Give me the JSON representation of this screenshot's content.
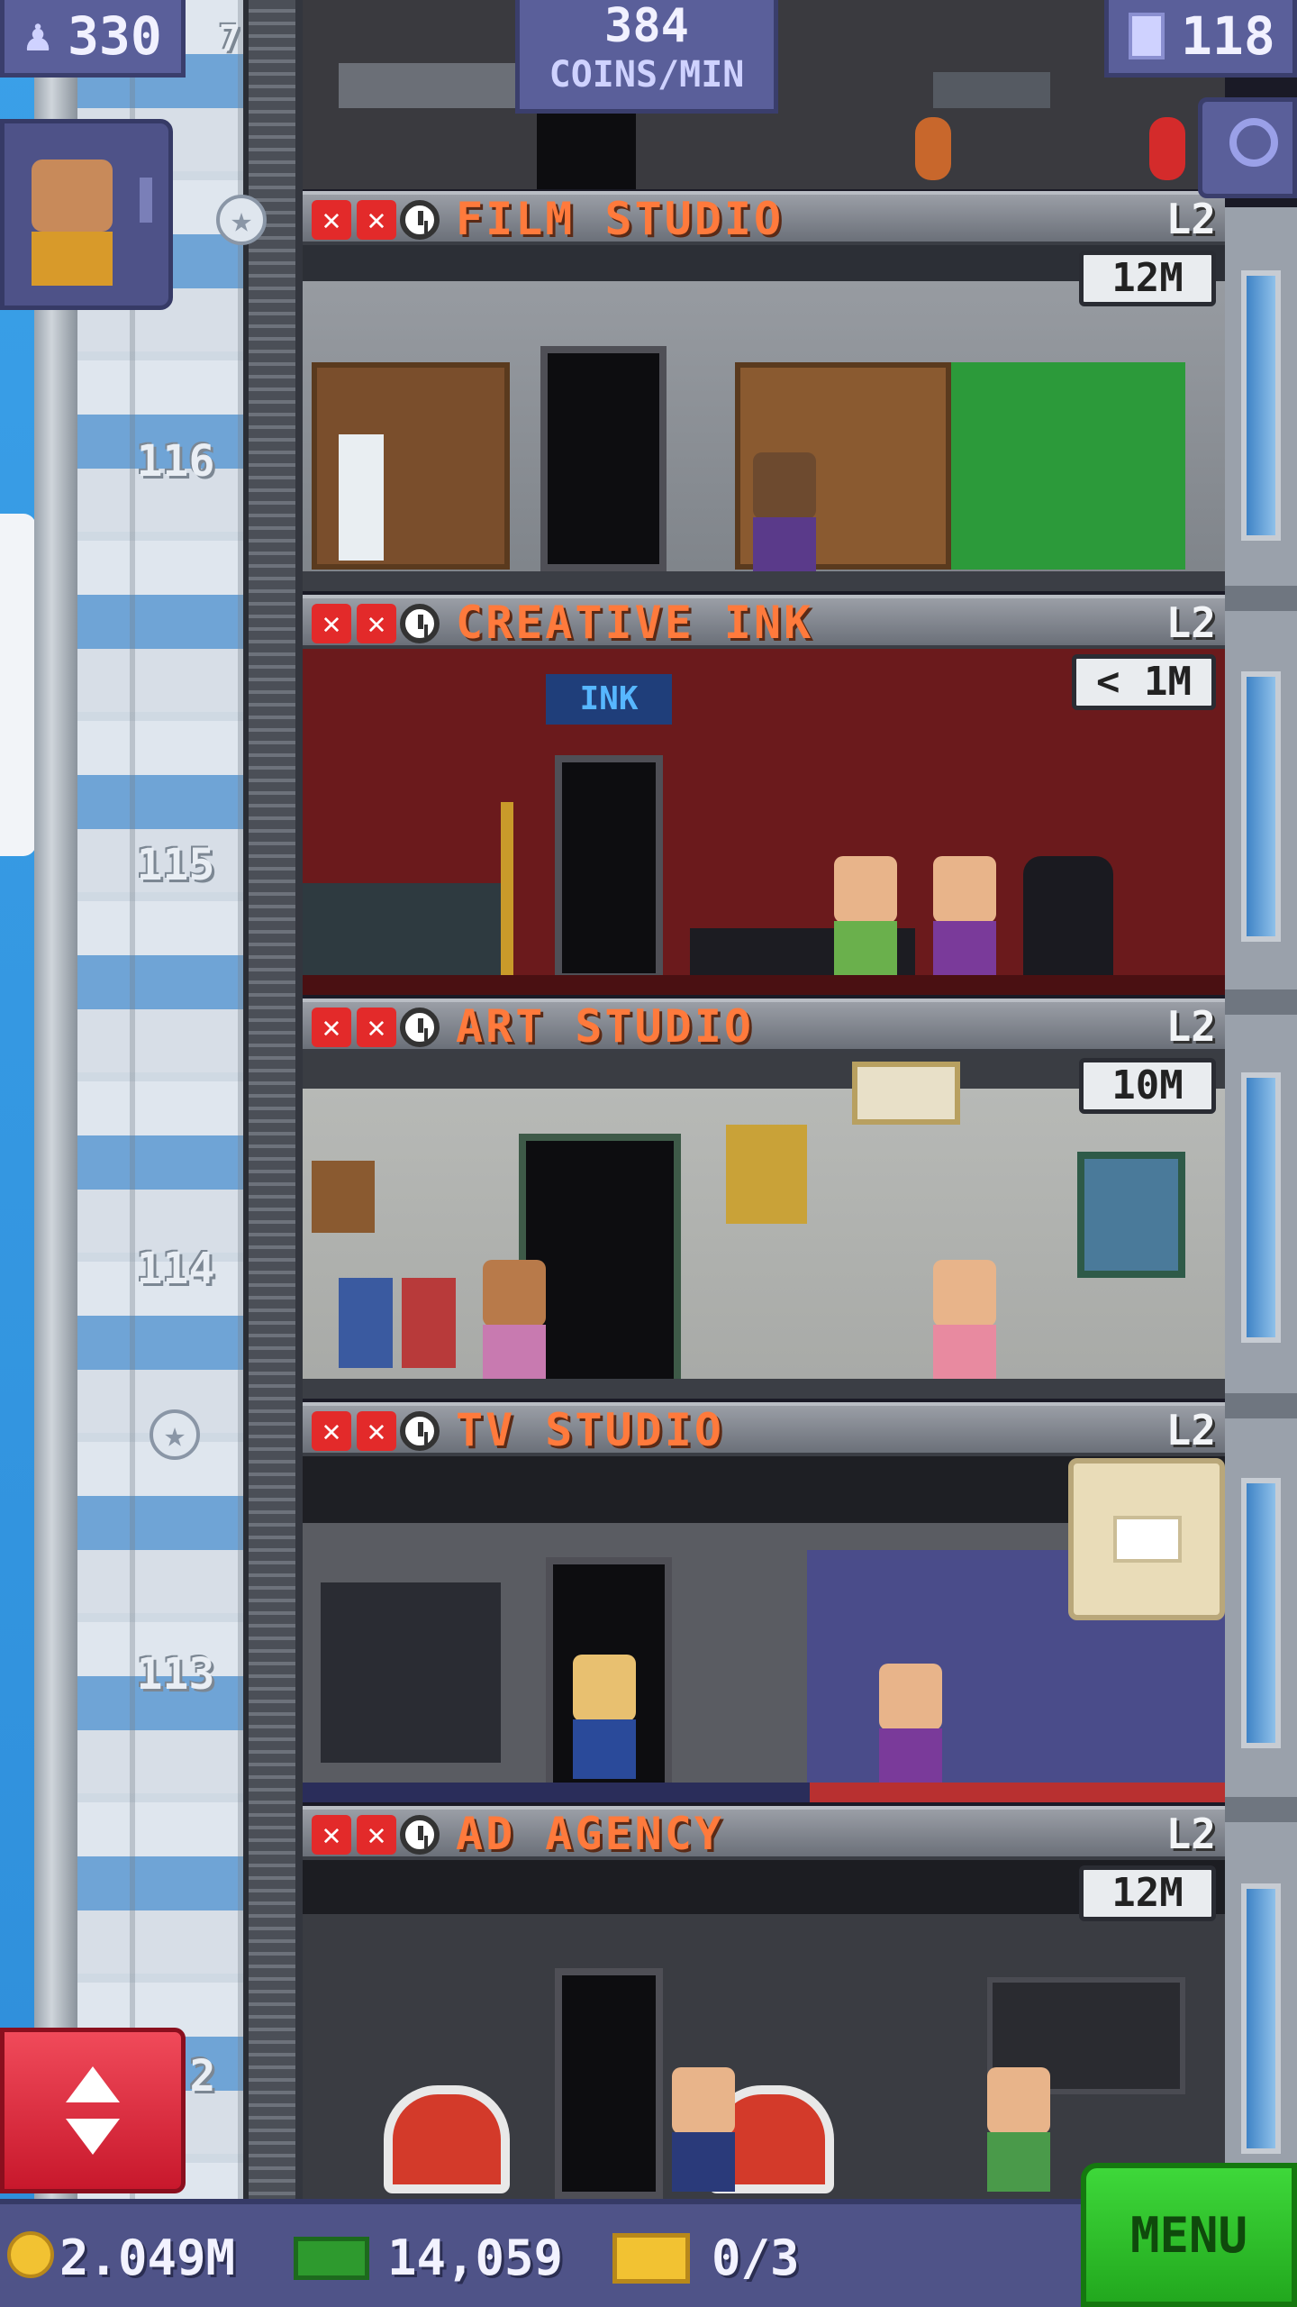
{
  "hud": {
    "population": "330",
    "coins_rate_value": "384",
    "coins_rate_unit": "COINS/MIN",
    "floors": "118"
  },
  "floor_numbers": [
    "116",
    "115",
    "114",
    "113",
    "2",
    "7"
  ],
  "rooms": [
    {
      "name": "FILM STUDIO",
      "level": "L2",
      "timer": "12M"
    },
    {
      "name": "CREATIVE INK",
      "level": "L2",
      "timer": "< 1M",
      "sign": "INK"
    },
    {
      "name": "ART STUDIO",
      "level": "L2",
      "timer": "10M"
    },
    {
      "name": "TV STUDIO",
      "level": "L2",
      "timer": ""
    },
    {
      "name": "AD AGENCY",
      "level": "L2",
      "timer": "12M"
    }
  ],
  "bottom": {
    "coins": "2.049M",
    "bux": "14,059",
    "tickets": "0/3",
    "menu": "MENU"
  },
  "icons": [
    "person-icon",
    "building-icon",
    "search-icon",
    "elevator-button-icon",
    "coin-icon",
    "bux-icon",
    "ticket-icon",
    "star-icon",
    "clock-icon",
    "x-icon",
    "crate-icon"
  ],
  "colors": {
    "room_name": "#ff7a3c",
    "menu": "#2fbf2a",
    "elevator_button": "#e8283f",
    "hud": "#5a5f9a"
  }
}
